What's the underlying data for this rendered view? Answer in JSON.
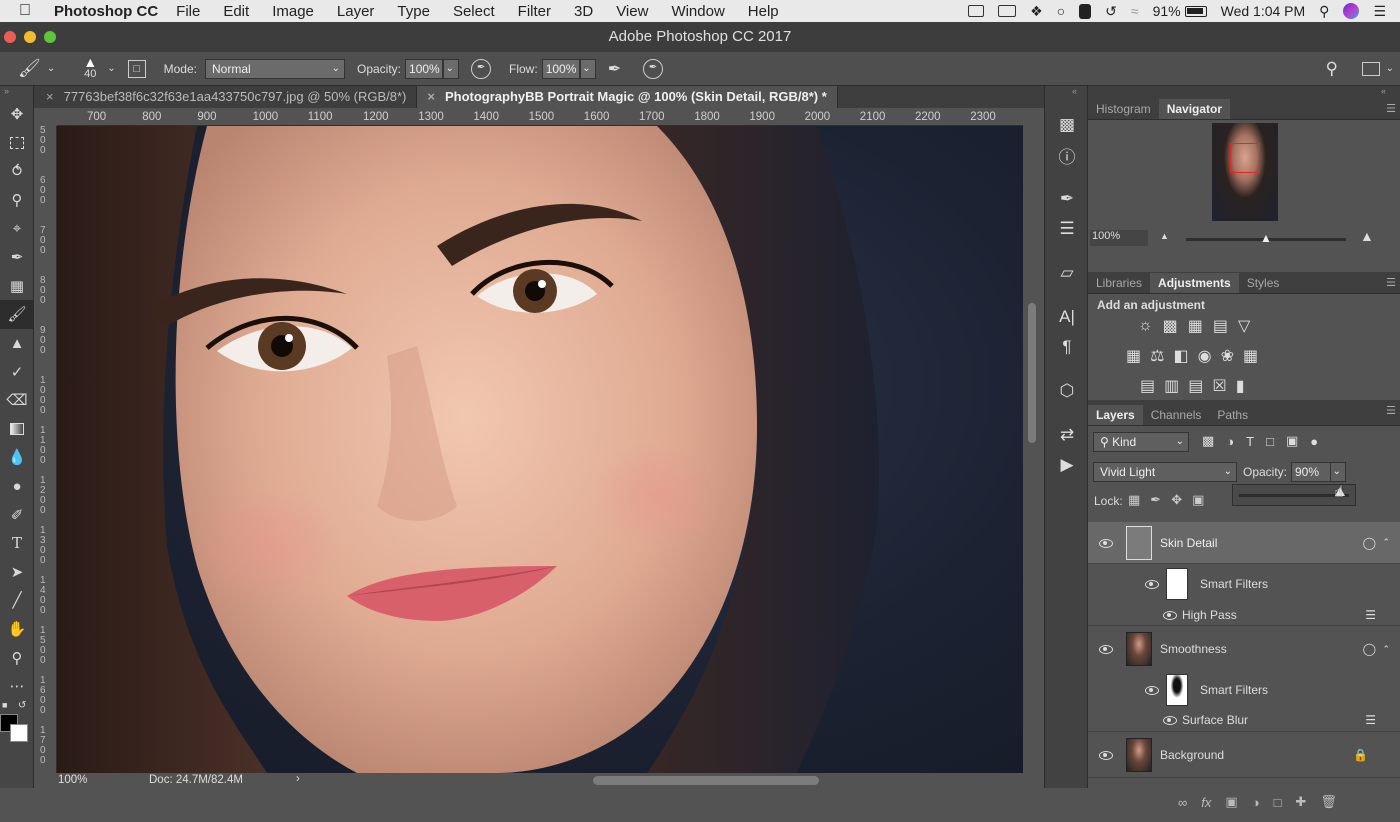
{
  "menubar": {
    "app_name": "Photoshop CC",
    "items": [
      "File",
      "Edit",
      "Image",
      "Layer",
      "Type",
      "Select",
      "Filter",
      "3D",
      "View",
      "Window",
      "Help"
    ],
    "battery": "91%",
    "clock": "Wed 1:04 PM"
  },
  "window": {
    "title": "Adobe Photoshop CC 2017"
  },
  "options": {
    "brush_size": "40",
    "mode_label": "Mode:",
    "mode_value": "Normal",
    "opacity_label": "Opacity:",
    "opacity_value": "100%",
    "flow_label": "Flow:",
    "flow_value": "100%"
  },
  "tabs": [
    {
      "label": "77763bef38f6c32f63e1aa433750c797.jpg @ 50% (RGB/8*)",
      "active": false
    },
    {
      "label": "PhotographyBB Portrait Magic @ 100% (Skin Detail, RGB/8*) *",
      "active": true
    }
  ],
  "ruler": {
    "h_ticks": [
      "700",
      "800",
      "900",
      "1000",
      "1100",
      "1200",
      "1300",
      "1400",
      "1500",
      "1600",
      "1700",
      "1800",
      "1900",
      "2000",
      "2100",
      "2200",
      "2300"
    ],
    "v_ticks": [
      "5 0 0",
      "6 0 0",
      "7 0 0",
      "8 0 0",
      "9 0 0",
      "1 0 0 0",
      "1 1 0 0",
      "1 2 0 0",
      "1 3 0 0",
      "1 4 0 0",
      "1 5 0 0",
      "1 6 0 0",
      "1 7 0 0"
    ]
  },
  "status": {
    "zoom": "100%",
    "doc": "Doc: 24.7M/82.4M"
  },
  "navigator": {
    "tabs": [
      "Histogram",
      "Navigator"
    ],
    "active": "Navigator",
    "zoom": "100%"
  },
  "adjustments": {
    "tabs": [
      "Libraries",
      "Adjustments",
      "Styles"
    ],
    "active": "Adjustments",
    "heading": "Add an adjustment"
  },
  "layers_panel": {
    "tabs": [
      "Layers",
      "Channels",
      "Paths"
    ],
    "active": "Layers",
    "filter_kind": "Kind",
    "blend_mode": "Vivid Light",
    "opacity_label": "Opacity:",
    "opacity_value": "90%",
    "lock_label": "Lock:",
    "layers": [
      {
        "name": "Skin Detail",
        "selected": true
      },
      {
        "name": "Smart Filters",
        "sub": true
      },
      {
        "name": "High Pass",
        "filter": true
      },
      {
        "name": "Smoothness"
      },
      {
        "name": "Smart Filters",
        "sub": true
      },
      {
        "name": "Surface Blur",
        "filter": true
      },
      {
        "name": "Background",
        "locked": true
      }
    ]
  },
  "colors": {
    "accent_highlight": "#686868",
    "ui_dark": "#3f3f3f"
  }
}
